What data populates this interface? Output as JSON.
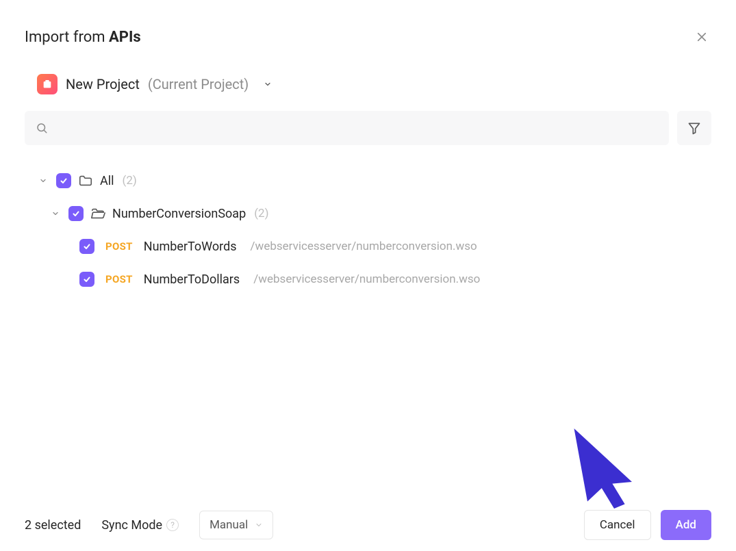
{
  "header": {
    "title_prefix": "Import from ",
    "title_bold": "APIs"
  },
  "project": {
    "name": "New Project",
    "suffix": "(Current Project)"
  },
  "search": {
    "placeholder": ""
  },
  "tree": {
    "root": {
      "label": "All",
      "count": "(2)"
    },
    "group": {
      "label": "NumberConversionSoap",
      "count": "(2)"
    },
    "endpoints": [
      {
        "method": "POST",
        "name": "NumberToWords",
        "path": "/webservicesserver/numberconversion.wso"
      },
      {
        "method": "POST",
        "name": "NumberToDollars",
        "path": "/webservicesserver/numberconversion.wso"
      }
    ]
  },
  "footer": {
    "selected_text": "2 selected",
    "sync_label": "Sync Mode",
    "sync_value": "Manual",
    "cancel_label": "Cancel",
    "add_label": "Add"
  }
}
